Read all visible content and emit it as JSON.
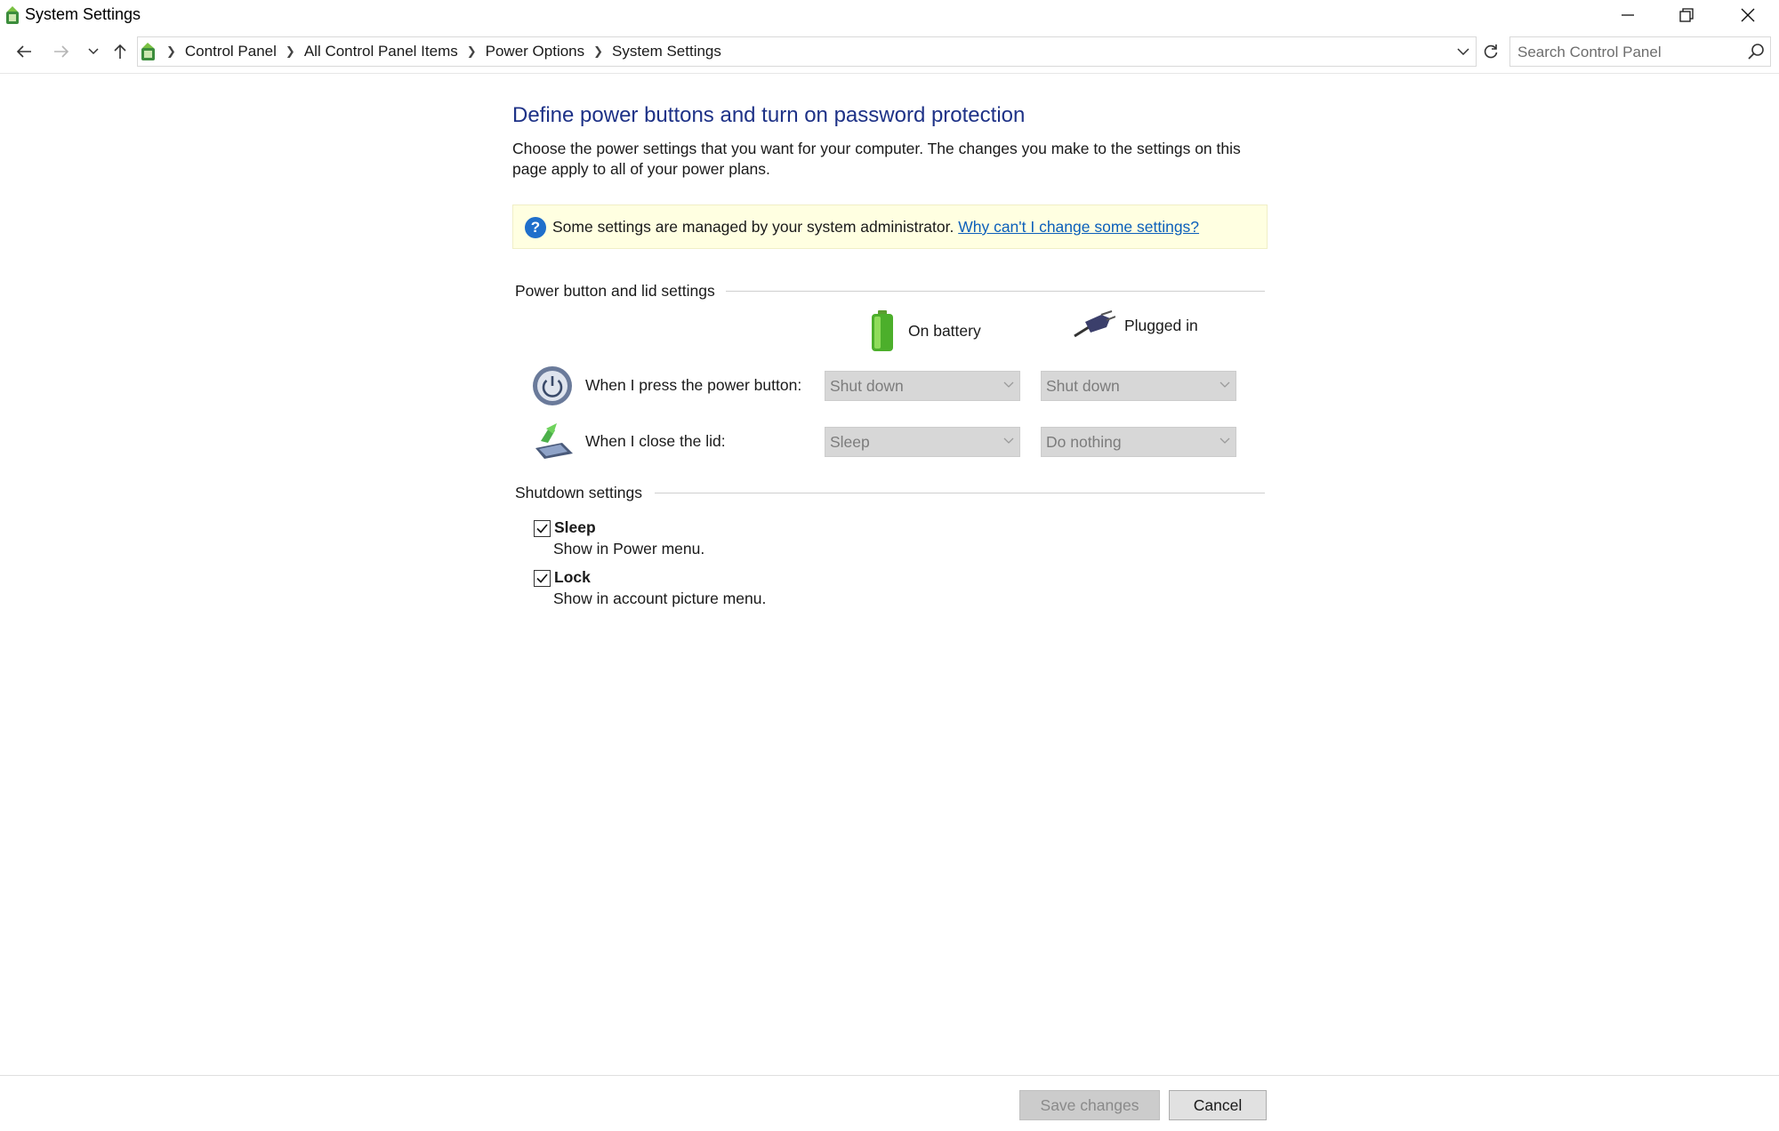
{
  "window": {
    "title": "System Settings",
    "controls": [
      "minimize-icon",
      "restore-icon",
      "close-icon"
    ]
  },
  "navigation": {
    "breadcrumbs": [
      "Control Panel",
      "All Control Panel Items",
      "Power Options",
      "System Settings"
    ],
    "search_placeholder": "Search Control Panel"
  },
  "page": {
    "title": "Define power buttons and turn on password protection",
    "description": "Choose the power settings that you want for your computer. The changes you make to the settings on this page apply to all of your power plans.",
    "info_message": "Some settings are managed by your system administrator.",
    "info_link": "Why can't I change some settings?"
  },
  "power_section": {
    "heading": "Power button and lid settings",
    "columns": [
      "On battery",
      "Plugged in"
    ],
    "rows": [
      {
        "label": "When I press the power button:",
        "on_battery": "Shut down",
        "plugged_in": "Shut down",
        "icon": "power-button-icon"
      },
      {
        "label": "When I close the lid:",
        "on_battery": "Sleep",
        "plugged_in": "Do nothing",
        "icon": "laptop-lid-icon"
      }
    ]
  },
  "shutdown_section": {
    "heading": "Shutdown settings",
    "options": [
      {
        "title": "Sleep",
        "subtitle": "Show in Power menu.",
        "checked": true
      },
      {
        "title": "Lock",
        "subtitle": "Show in account picture menu.",
        "checked": true
      }
    ]
  },
  "buttons": {
    "save": "Save changes",
    "cancel": "Cancel"
  },
  "colors": {
    "heading": "#1e3287",
    "link": "#0b5fba",
    "info_background": "#ffffe1"
  }
}
